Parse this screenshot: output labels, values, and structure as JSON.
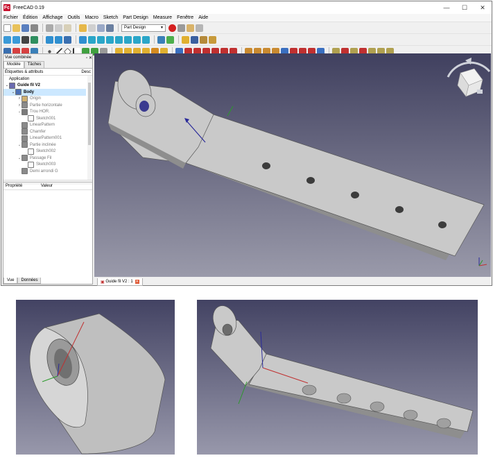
{
  "app": {
    "title": "FreeCAD 0.19",
    "logo": "Fc"
  },
  "menu": [
    "Fichier",
    "Édition",
    "Affichage",
    "Outils",
    "Macro",
    "Sketch",
    "Part Design",
    "Measure",
    "Fenêtre",
    "Aide"
  ],
  "toolbar": {
    "workbench": "Part Design"
  },
  "combo_view": {
    "title": "Vue combinée",
    "tabs": [
      "Modèle",
      "Tâches"
    ],
    "col_labels": "Étiquettes & attributs",
    "col_desc": "Desc",
    "tree": [
      {
        "label": "Application",
        "level": 0,
        "twist": "",
        "icon": "",
        "style": ""
      },
      {
        "label": "Guide fil V2",
        "level": 0,
        "twist": "⌄",
        "icon": "#6b6bb0",
        "style": "bold"
      },
      {
        "label": "Body",
        "level": 1,
        "twist": "⌄",
        "icon": "#4a6fb5",
        "style": "bold sel"
      },
      {
        "label": "Origin",
        "level": 2,
        "twist": ">",
        "icon": "#d0b070",
        "style": "grey"
      },
      {
        "label": "Partie horizontale",
        "level": 2,
        "twist": ">",
        "icon": "#8a8a8a",
        "style": "grey"
      },
      {
        "label": "Trou HOR.",
        "level": 2,
        "twist": "⌄",
        "icon": "#7a7a7a",
        "style": "grey"
      },
      {
        "label": "Sketch001",
        "level": 3,
        "twist": "",
        "icon": "#ffffff",
        "style": "grey"
      },
      {
        "label": "LinearPattern",
        "level": 2,
        "twist": "",
        "icon": "#8a8a8a",
        "style": "grey"
      },
      {
        "label": "Chamfer",
        "level": 2,
        "twist": "",
        "icon": "#8a8a8a",
        "style": "grey"
      },
      {
        "label": "LinearPattern001",
        "level": 2,
        "twist": "",
        "icon": "#8a8a8a",
        "style": "grey"
      },
      {
        "label": "Partie inclinée",
        "level": 2,
        "twist": "⌄",
        "icon": "#8a8a8a",
        "style": "grey"
      },
      {
        "label": "Sketch002",
        "level": 3,
        "twist": "",
        "icon": "#ffffff",
        "style": "grey"
      },
      {
        "label": "Passage Fil",
        "level": 2,
        "twist": "⌄",
        "icon": "#8a8a8a",
        "style": "grey"
      },
      {
        "label": "Sketch003",
        "level": 3,
        "twist": "",
        "icon": "#ffffff",
        "style": "grey"
      },
      {
        "label": "Demi arrondi G",
        "level": 2,
        "twist": "",
        "icon": "#8a8a8a",
        "style": "grey"
      }
    ],
    "prop_col1": "Propriété",
    "prop_col2": "Valeur",
    "bottom_tabs": [
      "Vue",
      "Données"
    ]
  },
  "document_tab": "Guide fil V2 : 1",
  "colors": {
    "part_face": "#c9c9c9",
    "part_side": "#8e8e8e",
    "bg_top": "#40405f",
    "bg_bottom": "#9a9aaa",
    "axis_x": "#c03030",
    "axis_y": "#2a9a2a",
    "axis_z": "#2a2a9a"
  }
}
